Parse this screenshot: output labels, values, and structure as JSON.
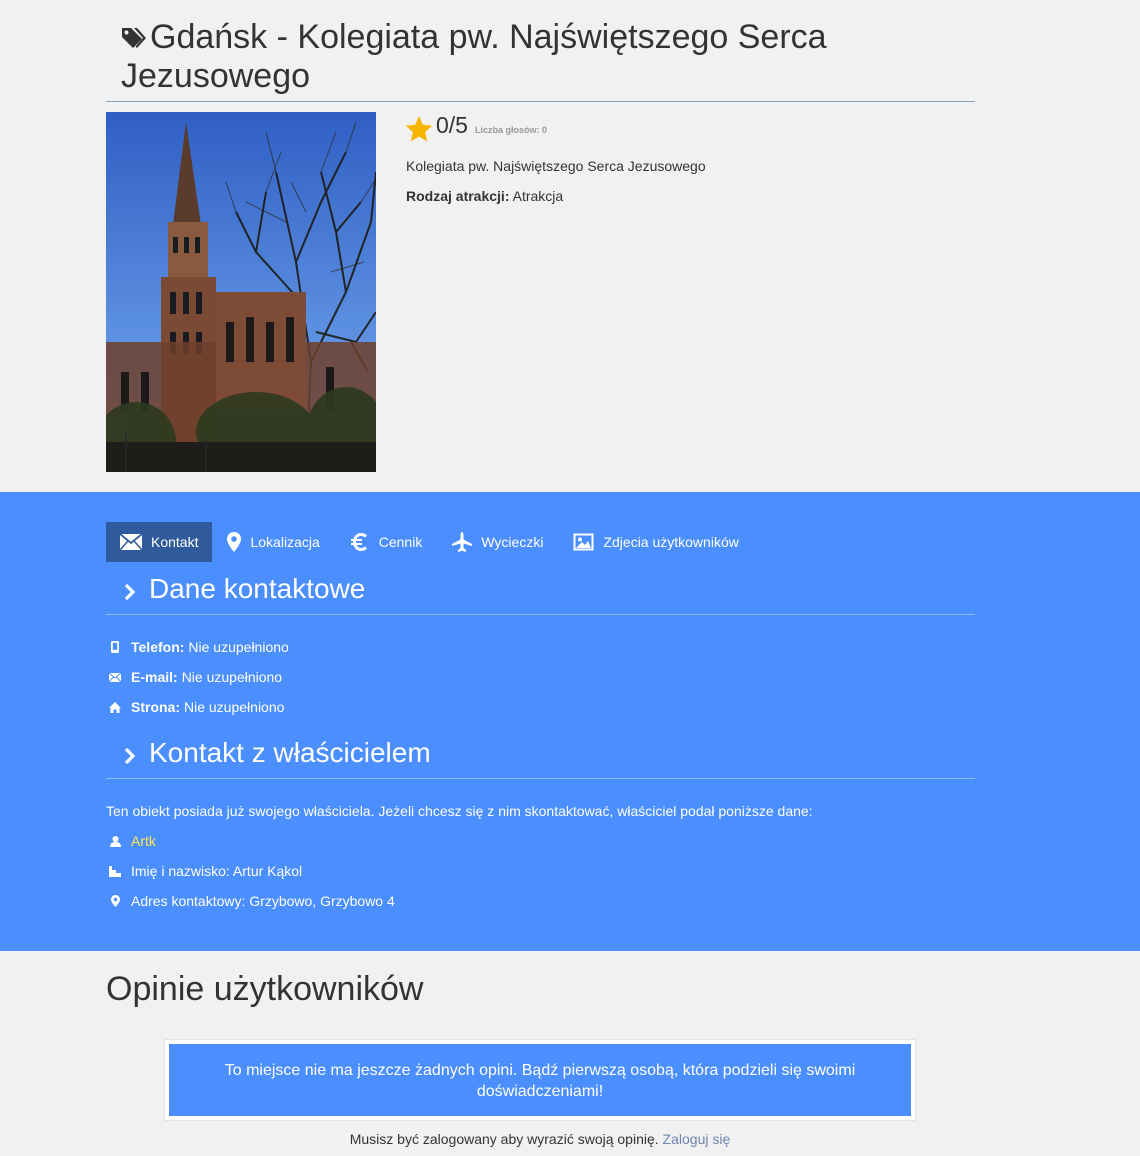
{
  "header": {
    "title": "Gdańsk - Kolegiata pw. Najświętszego Serca Jezusowego"
  },
  "rating": {
    "value": "0/5",
    "votes": "Liczba głosów: 0"
  },
  "info": {
    "description": "Kolegiata pw. Najświętszego Serca Jezusowego",
    "type_label": "Rodzaj atrakcji:",
    "type_value": "Atrakcja"
  },
  "tabs": [
    {
      "label": "Kontakt",
      "icon": "envelope-icon"
    },
    {
      "label": "Lokalizacja",
      "icon": "map-marker-icon"
    },
    {
      "label": "Cennik",
      "icon": "euro-icon"
    },
    {
      "label": "Wycieczki",
      "icon": "plane-icon"
    },
    {
      "label": "Zdjecia użytkowników",
      "icon": "picture-icon"
    }
  ],
  "contact": {
    "heading": "Dane kontaktowe",
    "phone_label": "Telefon:",
    "phone_value": "Nie uzupełniono",
    "email_label": "E-mail:",
    "email_value": "Nie uzupełniono",
    "site_label": "Strona:",
    "site_value": "Nie uzupełniono"
  },
  "owner": {
    "heading": "Kontakt z właścicielem",
    "note": "Ten obiekt posiada już swojego właściciela. Jeżeli chcesz się z nim skontaktować, właściciel podał poniższe dane:",
    "username": "Artk",
    "name": "Imię i nazwisko: Artur Kąkol",
    "address": "Adres kontaktowy: Grzybowo, Grzybowo 4"
  },
  "opinions": {
    "heading": "Opinie użytkowników",
    "empty": "To miejsce nie ma jeszcze żadnych opini. Bądź pierwszą osobą, która podzieli się swoimi doświadczeniami!",
    "login_note": "Musisz być zalogowany aby wyrazić swoją opinię.",
    "login_link": "Zaloguj się"
  },
  "colors": {
    "blue_section": "#4b8ffe",
    "active_tab": "#2f5b9c",
    "star": "#f7b500",
    "owner_link": "#ffe95a"
  }
}
